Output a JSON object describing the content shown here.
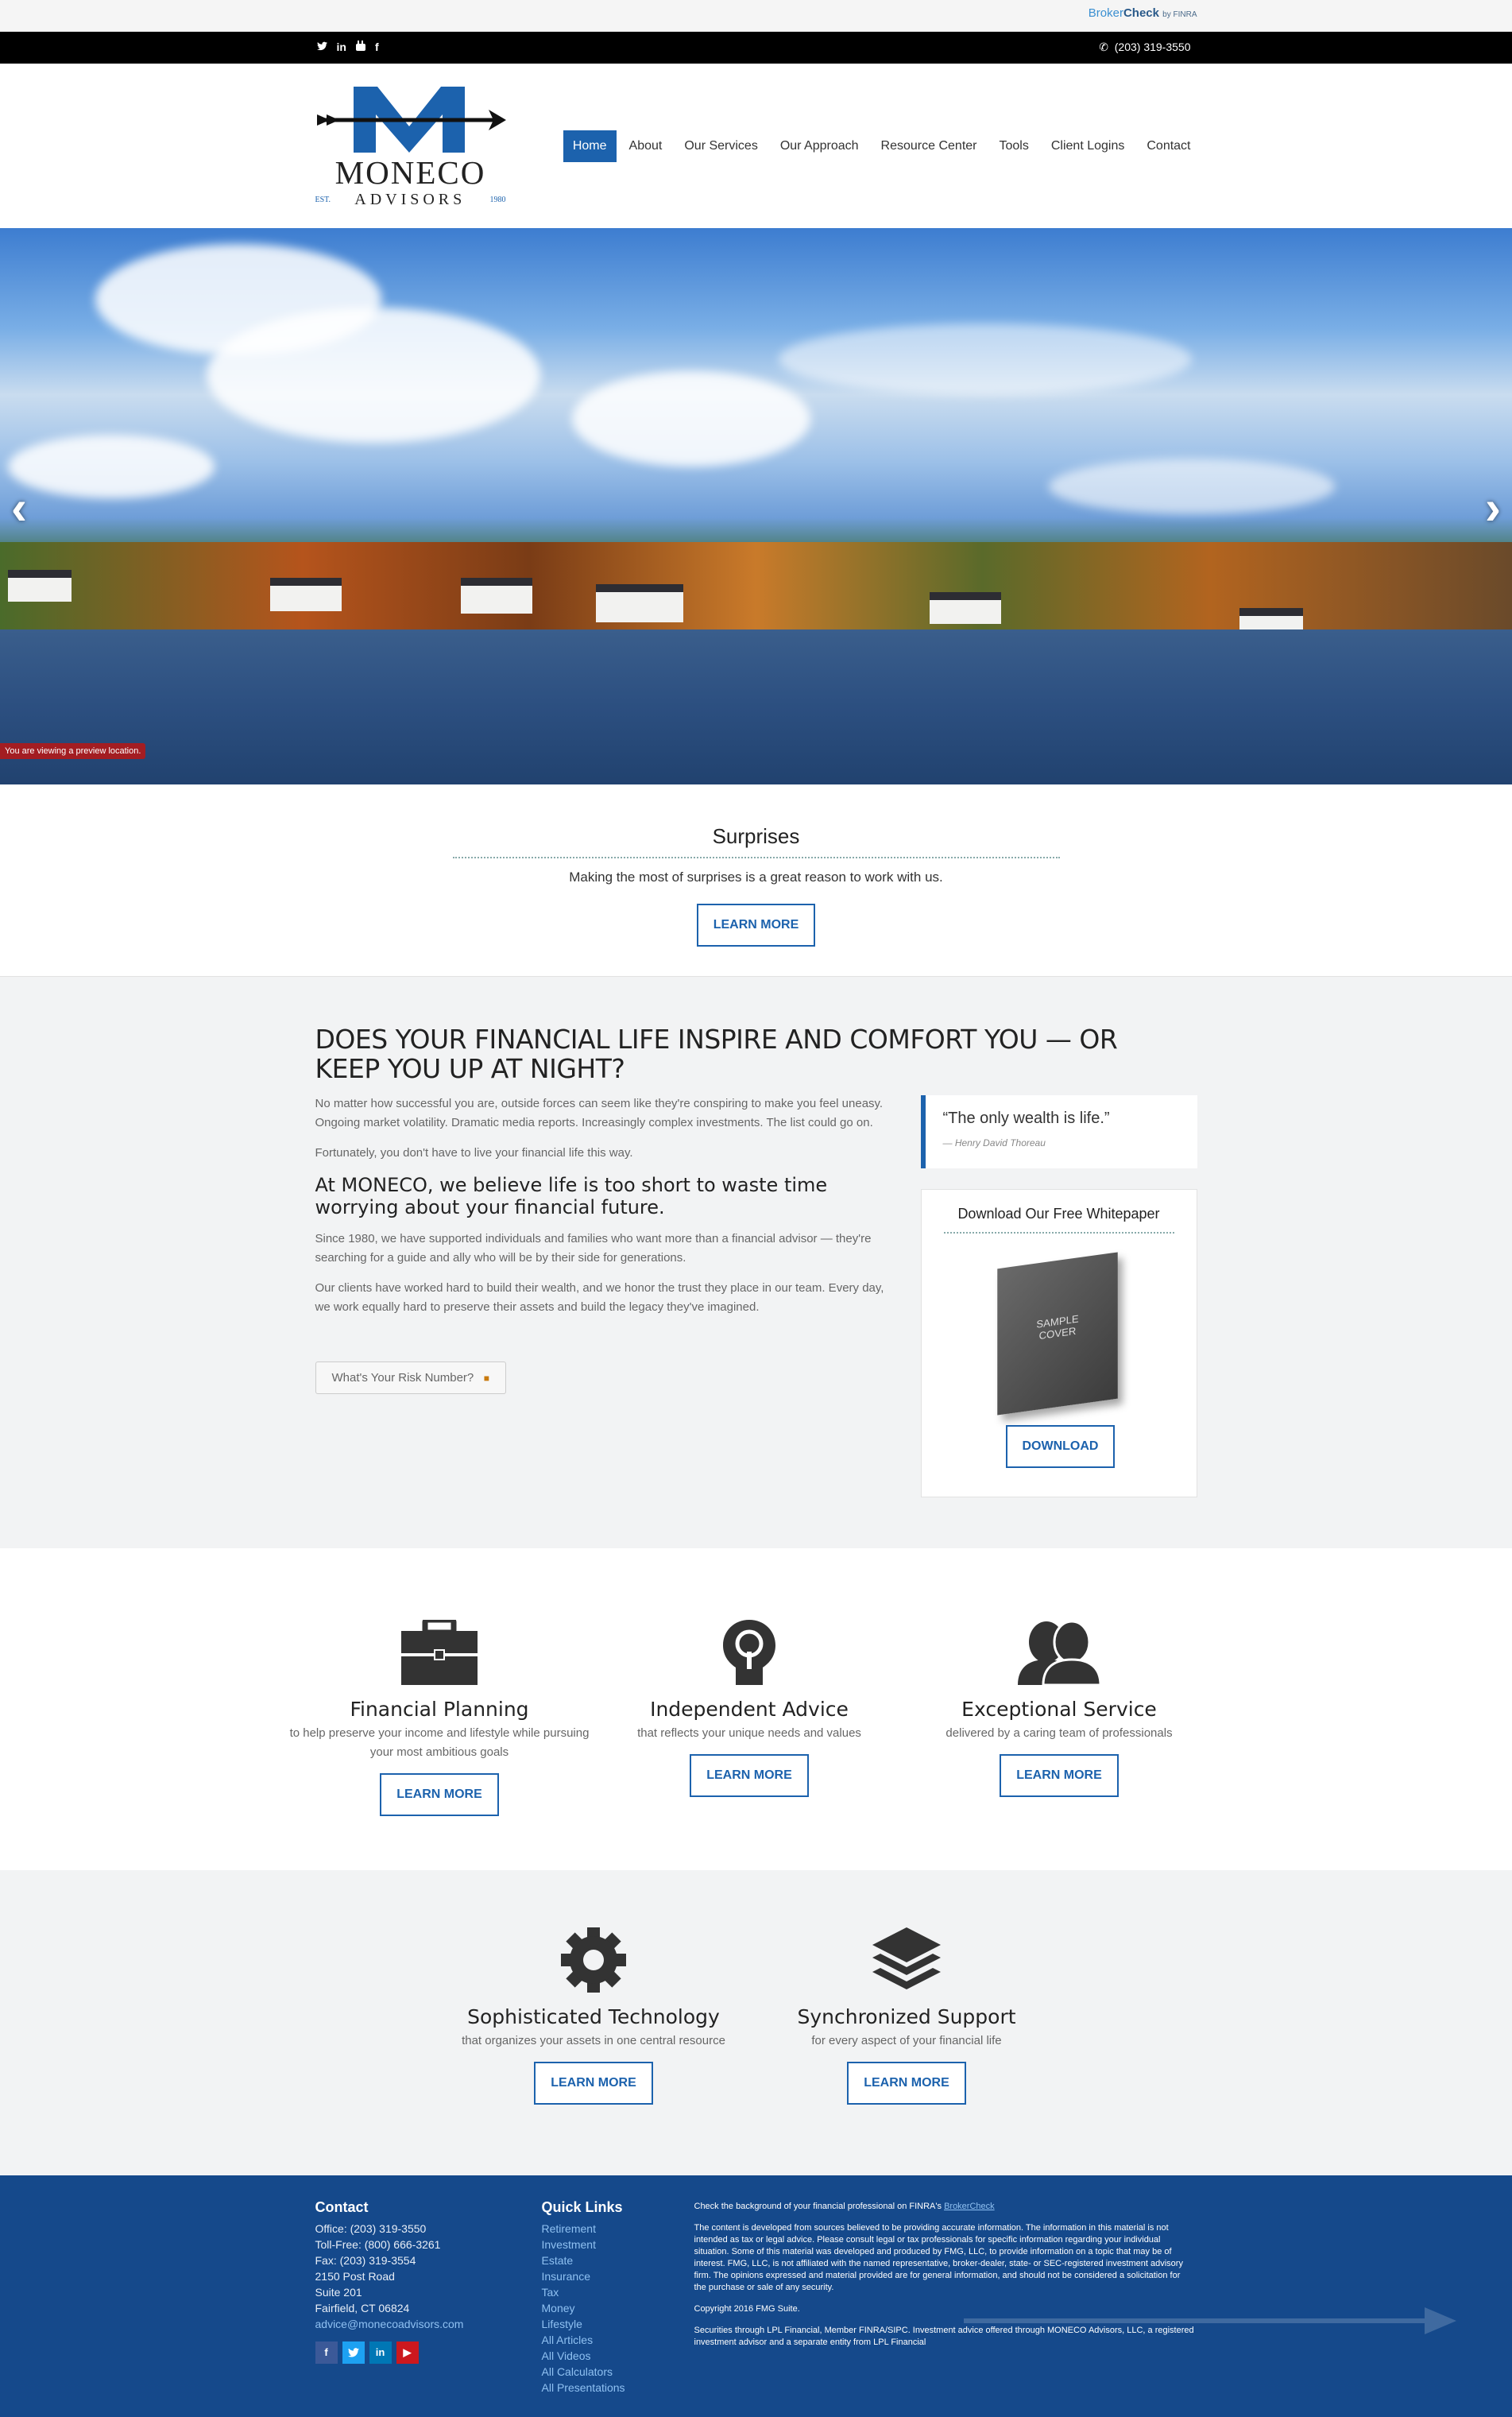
{
  "topbar": {
    "brokercheck_prefix": "Broker",
    "brokercheck_strong": "Check",
    "brokercheck_suffix": "by FINRA",
    "phone": "(203) 319-3550"
  },
  "social_top": [
    "twitter-icon",
    "linkedin-icon",
    "youtube-icon",
    "facebook-icon"
  ],
  "logo": {
    "word": "MONECO",
    "sub": "ADVISORS",
    "est": "EST.",
    "year": "1980"
  },
  "nav": [
    "Home",
    "About",
    "Our Services",
    "Our Approach",
    "Resource Center",
    "Tools",
    "Client Logins",
    "Contact"
  ],
  "hero": {
    "preview_label": "You are viewing a preview location."
  },
  "surprises": {
    "title": "Surprises",
    "text": "Making the most of surprises is a great reason to work with us.",
    "button": "LEARN MORE"
  },
  "intro": {
    "heading": "DOES YOUR FINANCIAL LIFE INSPIRE AND COMFORT YOU — OR KEEP YOU UP AT NIGHT?",
    "p1": "No matter how successful you are, outside forces can seem like they're conspiring to make you feel uneasy. Ongoing market volatility. Dramatic media reports. Increasingly complex investments. The list could go on.",
    "p2": "Fortunately, you don't have to live your financial life this way.",
    "subheading": "At MONECO, we believe life is too short to waste time worrying about your financial future.",
    "p3": "Since 1980, we have supported individuals and families who want more than a financial advisor — they're searching for a guide and ally who will be by their side for generations.",
    "p4": "Our clients have worked hard to build their wealth, and we honor the trust they place in our team. Every day, we work equally hard to preserve their assets and build the legacy they've imagined.",
    "risk_button": "What's Your Risk Number?"
  },
  "quote": {
    "text": "“The only wealth is life.”",
    "author": "— Henry David Thoreau"
  },
  "whitepaper": {
    "title": "Download Our Free Whitepaper",
    "cover_line1": "SAMPLE",
    "cover_line2": "COVER",
    "button": "DOWNLOAD"
  },
  "features_row1": [
    {
      "icon": "briefcase-icon",
      "title": "Financial Planning",
      "desc": "to help preserve your income and lifestyle while pursuing your most ambitious goals",
      "button": "LEARN MORE"
    },
    {
      "icon": "head-lightbulb-icon",
      "title": "Independent Advice",
      "desc": "that reflects your unique needs and values",
      "button": "LEARN MORE"
    },
    {
      "icon": "people-icon",
      "title": "Exceptional Service",
      "desc": "delivered by a caring team of professionals",
      "button": "LEARN MORE"
    }
  ],
  "features_row2": [
    {
      "icon": "gear-icon",
      "title": "Sophisticated Technology",
      "desc": "that organizes your assets in one central resource",
      "button": "LEARN MORE"
    },
    {
      "icon": "layers-icon",
      "title": "Synchronized Support",
      "desc": "for every aspect of your financial life",
      "button": "LEARN MORE"
    }
  ],
  "footer": {
    "contact_title": "Contact",
    "contact_lines": [
      "Office: (203) 319-3550",
      "Toll-Free: (800) 666-3261",
      "Fax: (203) 319-3554",
      "2150 Post Road",
      "Suite 201",
      "Fairfield, CT 06824"
    ],
    "email": "advice@monecoadvisors.com",
    "social": [
      "facebook-icon",
      "twitter-icon",
      "linkedin-icon",
      "youtube-icon"
    ],
    "quick_title": "Quick Links",
    "quick_links": [
      "Retirement",
      "Investment",
      "Estate",
      "Insurance",
      "Tax",
      "Money",
      "Lifestyle",
      "All Articles",
      "All Videos",
      "All Calculators",
      "All Presentations"
    ],
    "brokercheck_text": "Check the background of your financial professional on FINRA's",
    "brokercheck_link": "BrokerCheck",
    "disclaimer": "The content is developed from sources believed to be providing accurate information. The information in this material is not intended as tax or legal advice. Please consult legal or tax professionals for specific information regarding your individual situation. Some of this material was developed and produced by FMG, LLC, to provide information on a topic that may be of interest. FMG, LLC, is not affiliated with the named representative, broker-dealer, state- or SEC-registered investment advisory firm. The opinions expressed and material provided are for general information, and should not be considered a solicitation for the purchase or sale of any security.",
    "copyright": "Copyright 2016 FMG Suite.",
    "securities": "Securities through LPL Financial, Member FINRA/SIPC. Investment advice offered through MONECO Advisors, LLC, a registered investment advisor and a separate entity from LPL Financial"
  }
}
